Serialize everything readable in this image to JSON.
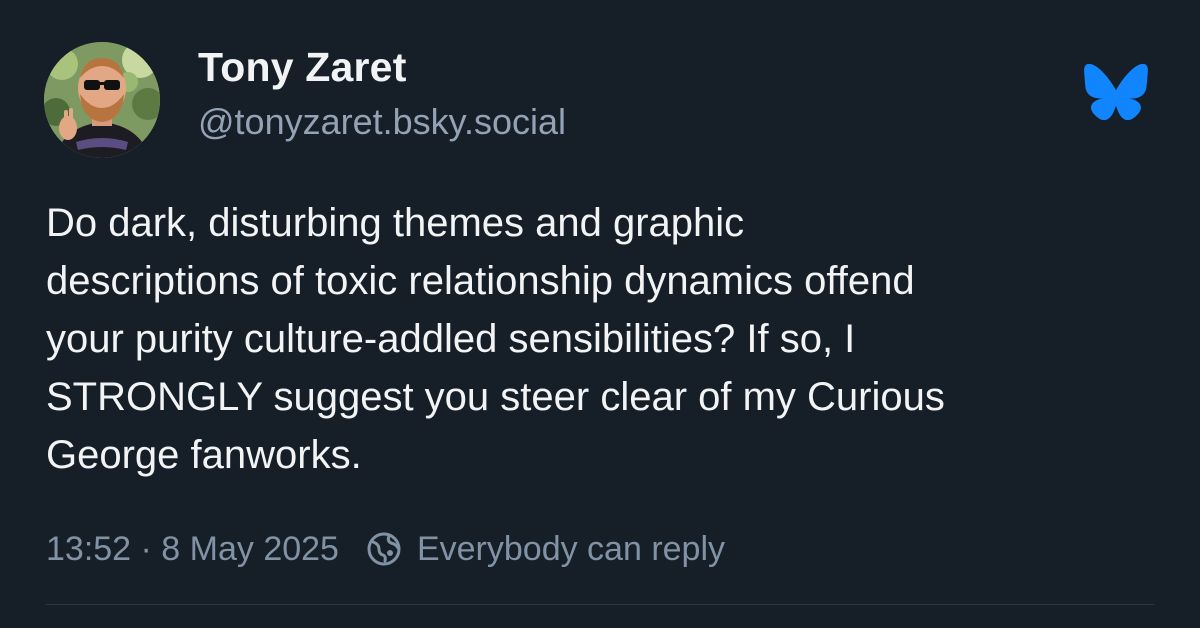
{
  "post": {
    "author": {
      "display_name": "Tony Zaret",
      "handle": "@tonyzaret.bsky.social",
      "avatar_icon": "avatar-photo"
    },
    "platform_icon": "bluesky-butterfly-icon",
    "text": "Do dark, disturbing themes and graphic\ndescriptions of toxic relationship dynamics offend\nyour purity culture-addled sensibilities? If so, I\nSTRONGLY suggest you steer clear of my Curious\nGeorge fanworks.",
    "timestamp": "13:52 · 8 May 2025",
    "reply_setting": {
      "icon": "globe-icon",
      "label": "Everybody can reply"
    }
  },
  "colors": {
    "background": "#161e27",
    "text": "#f1f3f5",
    "secondary_text": "#93a2b4",
    "bluesky_blue": "#1185fe"
  }
}
